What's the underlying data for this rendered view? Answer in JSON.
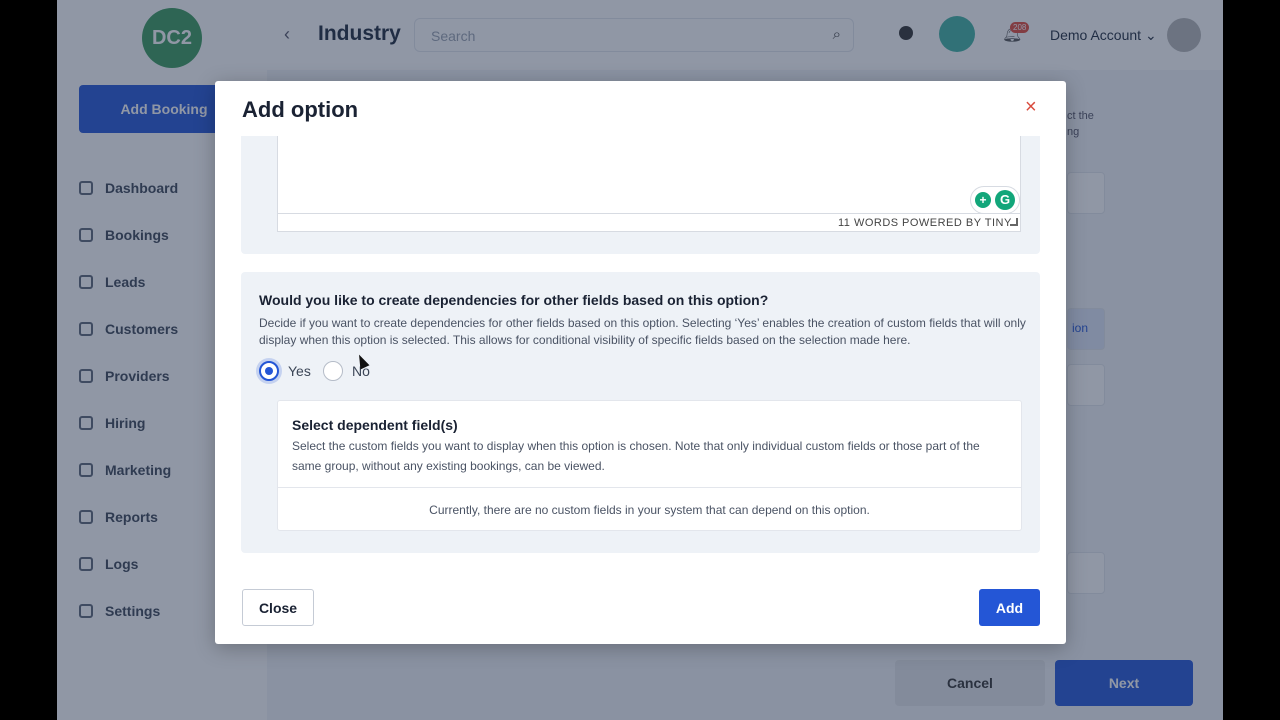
{
  "app": {
    "logo_text": "DC2",
    "page_title": "Industry",
    "search_placeholder": "Search",
    "notification_count": "208",
    "account_name": "Demo Account",
    "add_booking_label": "Add Booking"
  },
  "sidebar": {
    "items": [
      {
        "label": "Dashboard",
        "icon": "dashboard-icon"
      },
      {
        "label": "Bookings",
        "icon": "bookings-icon"
      },
      {
        "label": "Leads",
        "icon": "leads-icon"
      },
      {
        "label": "Customers",
        "icon": "customers-icon"
      },
      {
        "label": "Providers",
        "icon": "providers-icon"
      },
      {
        "label": "Hiring",
        "icon": "hiring-icon"
      },
      {
        "label": "Marketing",
        "icon": "marketing-icon"
      },
      {
        "label": "Reports",
        "icon": "reports-icon"
      },
      {
        "label": "Logs",
        "icon": "logs-icon"
      },
      {
        "label": "Settings",
        "icon": "settings-icon"
      }
    ]
  },
  "background": {
    "right_text_line1": "ct the",
    "right_text_line2": "ng",
    "partial_button": "ion",
    "cancel_label": "Cancel",
    "next_label": "Next"
  },
  "modal": {
    "title": "Add option",
    "close_icon": "×",
    "editor": {
      "word_count": "11 WORDS",
      "powered_by": "POWERED BY TINY"
    },
    "dependency": {
      "question": "Would you like to create dependencies for other fields based on this option?",
      "description": "Decide if you want to create dependencies for other fields based on this option. Selecting ‘Yes’ enables the creation of custom fields that will only display when this option is selected. This allows for conditional visibility of specific fields based on the selection made here.",
      "yes_label": "Yes",
      "no_label": "No",
      "selected": "Yes"
    },
    "dependent_fields": {
      "title": "Select dependent field(s)",
      "description": "Select the custom fields you want to display when this option is chosen. Note that only individual custom fields or those part of the same group, without any existing bookings, can be viewed.",
      "empty_message": "Currently, there are no custom fields in your system that can depend on this option."
    },
    "close_button": "Close",
    "add_button": "Add"
  },
  "colors": {
    "primary": "#2456d6",
    "close_icon": "#d94b3d",
    "panel_bg": "#eef2f7",
    "grammarly": "#12a67a"
  }
}
